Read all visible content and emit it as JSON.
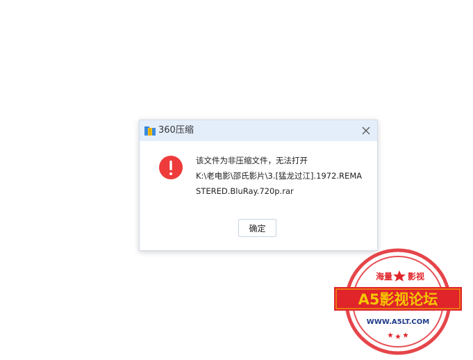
{
  "dialog": {
    "title": "360压缩",
    "message_lines": [
      "该文件为非压缩文件，无法打开",
      "K:\\老电影\\邵氏影片\\3.[猛龙过江].1972.REMA",
      "STERED.BluRay.720p.rar"
    ],
    "ok_label": "确定",
    "close_icon": "close-icon",
    "app_icon": "archive-folder-icon",
    "error_icon": "exclamation-circle-icon"
  },
  "watermark": {
    "top_text_left": "海量",
    "top_text_right": "影视",
    "banner_text": "A5影视论坛",
    "url_text": "WWW.A5LT.COM",
    "colors": {
      "red": "#e0242a",
      "yellow": "#f5c600"
    }
  },
  "colors": {
    "titlebar_bg": "#e4eefa",
    "error_red": "#ee3b3b"
  }
}
